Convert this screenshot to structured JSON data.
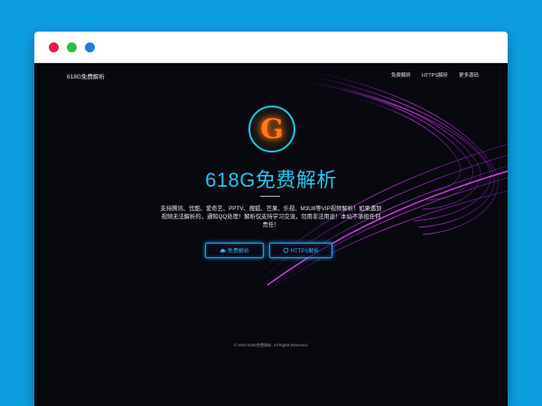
{
  "site": {
    "brand": "618G免费解析",
    "title": "618G免费解析",
    "logo_letter": "G",
    "description": "支持腾讯、优酷、爱奇艺、PPTV、搜狐、芒果、乐视、M3U8等VIP视频解析！如果遇到视频无法解析的，通知QQ处理！解析仅支持学习交流，勿用非法用途！本站不承担任何责任！",
    "footer": "© 2019 618G免费解析. All Rights Reserved."
  },
  "nav": {
    "links": [
      "免费解析",
      "HTTPS解析",
      "更多源码"
    ]
  },
  "buttons": {
    "free": {
      "label": "免费解析",
      "icon": "cloud-icon"
    },
    "https": {
      "label": "HTTPS解析",
      "icon": "refresh-icon"
    }
  },
  "colors": {
    "background": "#0d9ee0",
    "accent": "#28c4f0",
    "swirl": "#c832e6",
    "button_border": "#1f9fef"
  }
}
